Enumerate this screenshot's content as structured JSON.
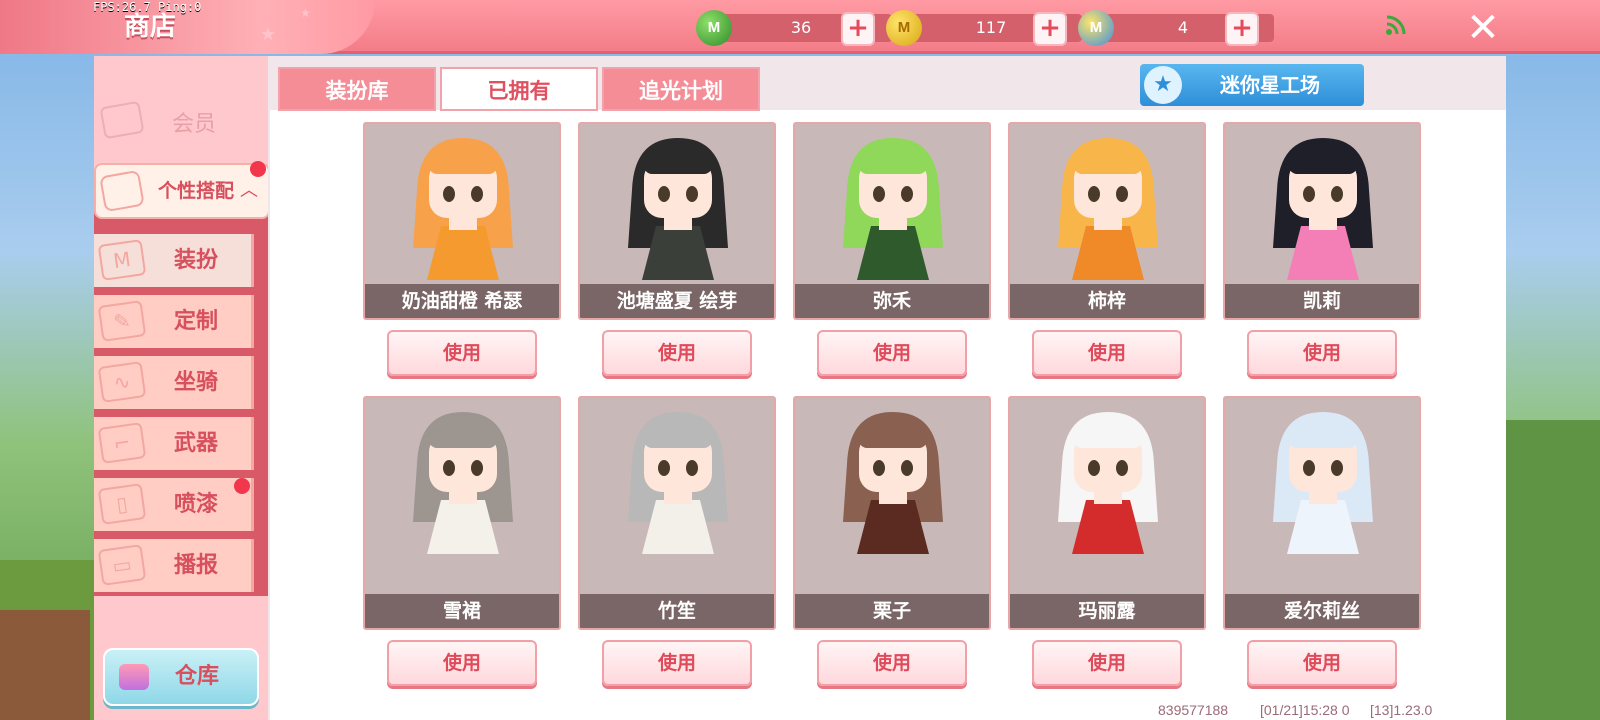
{
  "debug": {
    "fps_text": "FPS:26.7  Ping:0"
  },
  "header": {
    "title": "商店",
    "currencies": [
      {
        "icon": "green-gem-icon",
        "value": "36"
      },
      {
        "icon": "gold-coin-icon",
        "value": "117"
      },
      {
        "icon": "blue-coin-icon",
        "value": "4"
      }
    ],
    "close_glyph": "✕"
  },
  "sidebar": {
    "member_label": "会员",
    "group_label": "个性搭配",
    "group_glyph": "︿",
    "items": [
      {
        "label": "装扮",
        "icon": "outfit-icon",
        "glyph": "M",
        "active": true
      },
      {
        "label": "定制",
        "icon": "custom-icon",
        "glyph": "✎",
        "active": false
      },
      {
        "label": "坐骑",
        "icon": "mount-icon",
        "glyph": "∿",
        "active": false
      },
      {
        "label": "武器",
        "icon": "weapon-icon",
        "glyph": "⌐",
        "active": false
      },
      {
        "label": "喷漆",
        "icon": "spray-icon",
        "glyph": "▯",
        "active": false,
        "badge": true
      },
      {
        "label": "播报",
        "icon": "broadcast-icon",
        "glyph": "▭",
        "active": false
      }
    ],
    "warehouse_label": "仓库"
  },
  "tabs": [
    {
      "label": "装扮库",
      "active": false
    },
    {
      "label": "已拥有",
      "active": true
    },
    {
      "label": "追光计划",
      "active": false
    }
  ],
  "mini_factory_label": "迷你星工场",
  "use_label": "使用",
  "outfits": [
    {
      "name": "奶油甜橙 希瑟",
      "hair": "#f7a24a",
      "dress": "#f59a2f"
    },
    {
      "name": "池塘盛夏 绘芽",
      "hair": "#2a2a2a",
      "dress": "#3a3f3a"
    },
    {
      "name": "弥禾",
      "hair": "#8fd85a",
      "dress": "#2f5a2b"
    },
    {
      "name": "柿梓",
      "hair": "#f7b54a",
      "dress": "#f08a28"
    },
    {
      "name": "凯莉",
      "hair": "#1f1f2a",
      "dress": "#f47fb6"
    },
    {
      "name": "雪裙",
      "hair": "#9c9590",
      "dress": "#f4f0ea"
    },
    {
      "name": "竹笙",
      "hair": "#b8b8b8",
      "dress": "#f2f0e8"
    },
    {
      "name": "栗子",
      "hair": "#8a6050",
      "dress": "#5b2a20"
    },
    {
      "name": "玛丽露",
      "hair": "#f6f6f6",
      "dress": "#d42c2c"
    },
    {
      "name": "爱尔莉丝",
      "hair": "#dbe8f6",
      "dress": "#eef4fb"
    }
  ],
  "footer": {
    "uid": "839577188",
    "timestamp": "[01/21]15:28 0",
    "version": "[13]1.23.0"
  }
}
